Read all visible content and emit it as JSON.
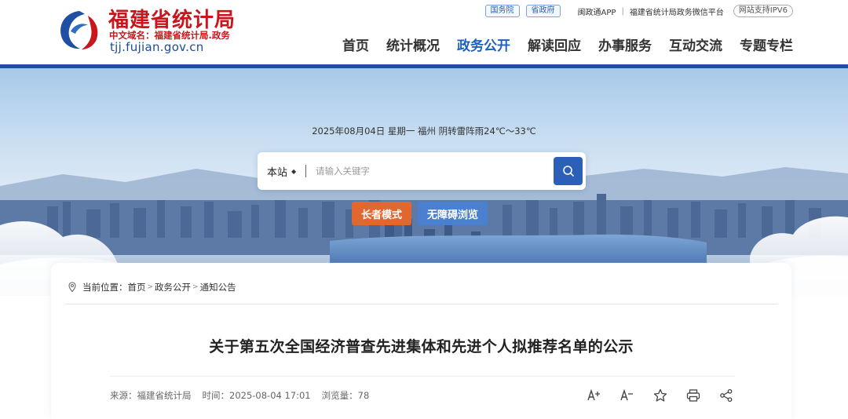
{
  "header": {
    "site_title": "福建省统计局",
    "cn_domain": "中文域名：福建省统计局.政务",
    "domain": "tjj.fujian.gov.cn",
    "top_links": {
      "state_council": "国务院",
      "province_gov": "省政府",
      "app": "闽政通APP",
      "wechat": "福建省统计局政务微信平台",
      "ipv6": "网站支持IPV6"
    },
    "nav": [
      "首页",
      "统计概况",
      "政务公开",
      "解读回应",
      "办事服务",
      "互动交流",
      "专题专栏"
    ],
    "active_nav": "政务公开"
  },
  "banner": {
    "date_weather": "2025年08月04日   星期一   福州  阴转雷阵雨24℃～33℃",
    "search": {
      "scope": "本站",
      "placeholder": "请输入关键字"
    },
    "elder_mode": "长者模式",
    "accessible": "无障碍浏览"
  },
  "content": {
    "breadcrumb": {
      "prefix": "当前位置：",
      "items": [
        "首页",
        "政务公开",
        "通知公告"
      ]
    },
    "title": "关于第五次全国经济普查先进集体和先进个人拟推荐名单的公示",
    "meta": {
      "source": "来源：福建省统计局",
      "time": "时间：2025-08-04 17:01",
      "views": "浏览量：78"
    },
    "tools": [
      "font-increase-icon",
      "font-decrease-icon",
      "star-icon",
      "print-icon",
      "share-icon"
    ]
  },
  "colors": {
    "brand_red": "#c8161d",
    "brand_blue": "#1f4fa3",
    "active_nav": "#1e5fbf",
    "elder_orange": "#e0682e",
    "access_blue": "#4b7fd0"
  }
}
